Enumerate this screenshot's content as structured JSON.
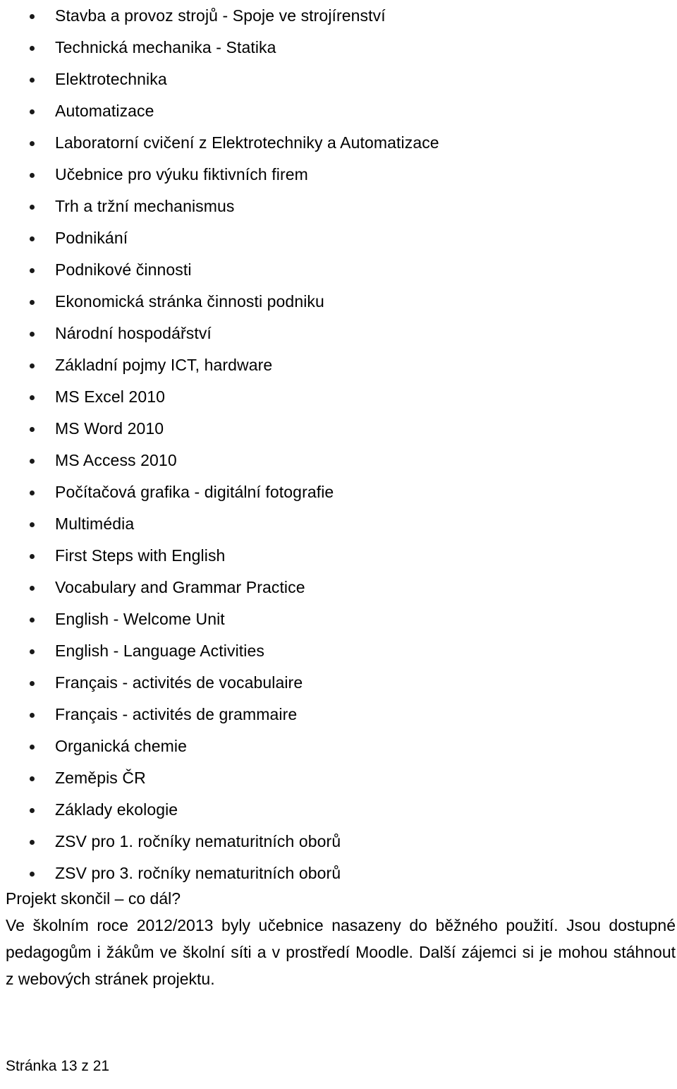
{
  "document": {
    "language": "cs",
    "background_color": "#ffffff",
    "text_color": "#000000"
  },
  "list": {
    "bullet_glyph": "•",
    "items": [
      {
        "label": "Stavba a provoz strojů - Spoje ve strojírenství"
      },
      {
        "label": "Technická mechanika - Statika"
      },
      {
        "label": "Elektrotechnika"
      },
      {
        "label": "Automatizace"
      },
      {
        "label": "Laboratorní cvičení z Elektrotechniky a Automatizace"
      },
      {
        "label": "Učebnice pro výuku fiktivních firem"
      },
      {
        "label": "Trh a tržní mechanismus"
      },
      {
        "label": "Podnikání"
      },
      {
        "label": "Podnikové činnosti"
      },
      {
        "label": "Ekonomická stránka činnosti podniku"
      },
      {
        "label": "Národní hospodářství"
      },
      {
        "label": "Základní pojmy ICT, hardware"
      },
      {
        "label": "MS Excel 2010"
      },
      {
        "label": "MS Word 2010"
      },
      {
        "label": "MS Access 2010"
      },
      {
        "label": "Počítačová grafika - digitální fotografie"
      },
      {
        "label": "Multimédia"
      },
      {
        "label": "First Steps with English"
      },
      {
        "label": "Vocabulary and Grammar Practice"
      },
      {
        "label": "English - Welcome Unit"
      },
      {
        "label": "English - Language Activities"
      },
      {
        "label": "Français - activités de vocabulaire"
      },
      {
        "label": "Français - activités de grammaire"
      },
      {
        "label": "Organická chemie"
      },
      {
        "label": "Zeměpis ČR"
      },
      {
        "label": "Základy ekologie"
      },
      {
        "label": "ZSV pro 1. ročníky nematuritních oborů"
      },
      {
        "label": "ZSV pro 3. ročníky nematuritních oborů"
      }
    ]
  },
  "heading": {
    "text": "Projekt skončil – co dál?"
  },
  "paragraph": {
    "lines": [
      "Ve školním roce 2012/2013 byly učebnice nasazeny do běžného použití. Jsou dostupné",
      "pedagogům i žákům ve školní síti a v prostředí Moodle. Další zájemci si je mohou stáhnout",
      "z webových stránek projektu."
    ],
    "full_text": "Ve školním roce 2012/2013 byly učebnice nasazeny do běžného použití. Jsou dostupné pedagogům i žákům ve školní síti a v prostředí Moodle. Další zájemci si je mohou stáhnout z webových stránek projektu."
  },
  "footer": {
    "page_label": "Stránka 13 z 21",
    "current_page": 13,
    "total_pages": 21
  }
}
